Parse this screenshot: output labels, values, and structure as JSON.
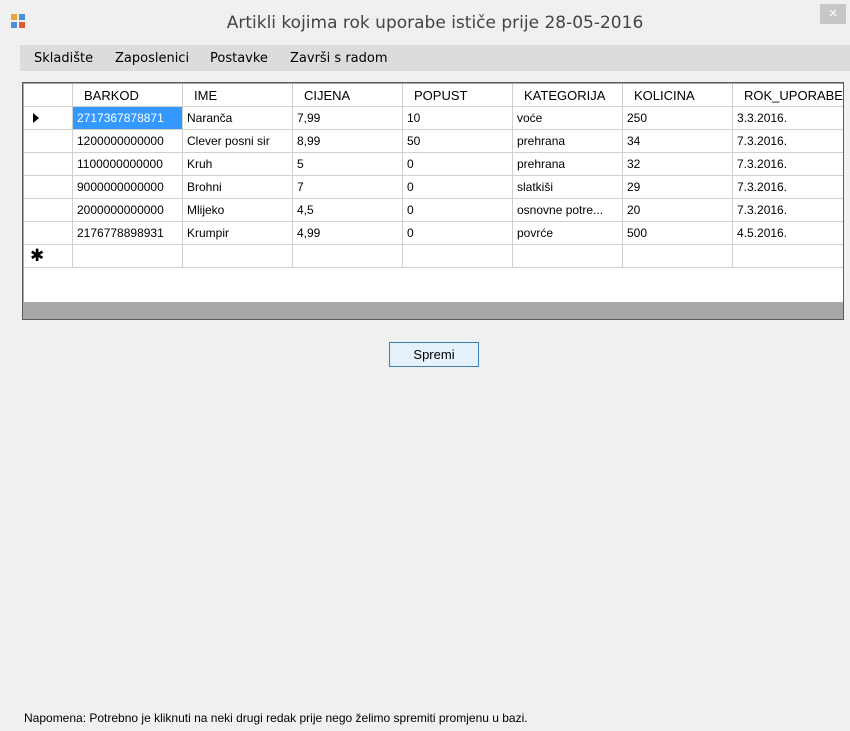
{
  "window": {
    "title": "Artikli kojima rok uporabe ističe prije 28-05-2016",
    "close_glyph": "×"
  },
  "menu": {
    "items": [
      "Skladište",
      "Zaposlenici",
      "Postavke",
      "Završi s radom"
    ]
  },
  "table": {
    "columns": [
      "BARKOD",
      "IME",
      "CIJENA",
      "POPUST",
      "KATEGORIJA",
      "KOLICINA",
      "ROK_UPORABE"
    ],
    "rows": [
      [
        "2717367878871",
        "Naranča",
        "7,99",
        "10",
        "voće",
        "250",
        "3.3.2016."
      ],
      [
        "1200000000000",
        "Clever posni sir",
        "8,99",
        "50",
        "prehrana",
        "34",
        "7.3.2016."
      ],
      [
        "1100000000000",
        "Kruh",
        "5",
        "0",
        "prehrana",
        "32",
        "7.3.2016."
      ],
      [
        "9000000000000",
        "Brohni",
        "7",
        "0",
        "slatkiši",
        "29",
        "7.3.2016."
      ],
      [
        "2000000000000",
        "Mlijeko",
        "4,5",
        "0",
        "osnovne potre...",
        "20",
        "7.3.2016."
      ],
      [
        "2176778898931",
        "Krumpir",
        "4,99",
        "0",
        "povrće",
        "500",
        "4.5.2016."
      ]
    ],
    "new_row_glyph": "✱"
  },
  "buttons": {
    "save_label": "Spremi"
  },
  "footer": {
    "note": "Napomena: Potrebno je kliknuti na neki drugi redak prije nego želimo spremiti promjenu u bazi."
  },
  "colors": {
    "selection": "#3399ff",
    "button_border": "#3c7fb1"
  }
}
